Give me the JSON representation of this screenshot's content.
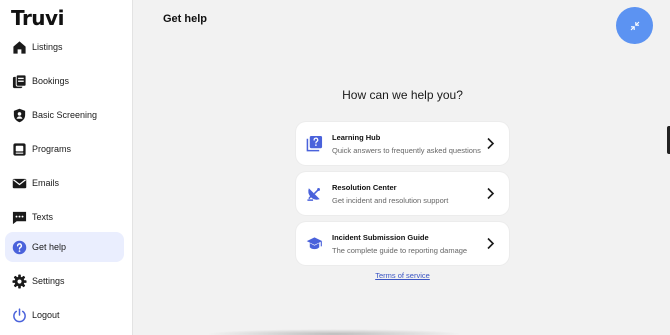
{
  "brand": {
    "logo_text": "Truvi",
    "accent_color": "#5c93f2",
    "active_bg": "#eaeefe"
  },
  "sidebar": {
    "items": [
      {
        "label": "Listings",
        "icon": "house-icon",
        "active": false
      },
      {
        "label": "Bookings",
        "icon": "bookings-icon",
        "active": false
      },
      {
        "label": "Basic Screening",
        "icon": "shield-user-icon",
        "active": false
      },
      {
        "label": "Programs",
        "icon": "programs-icon",
        "active": false
      },
      {
        "label": "Emails",
        "icon": "envelope-icon",
        "active": false
      },
      {
        "label": "Texts",
        "icon": "chat-bubble-icon",
        "active": false
      },
      {
        "label": "Get help",
        "icon": "question-circle-icon",
        "active": true
      },
      {
        "label": "Settings",
        "icon": "gear-icon",
        "active": false
      },
      {
        "label": "Logout",
        "icon": "power-icon",
        "active": false
      }
    ]
  },
  "header": {
    "title": "Get help",
    "fab_icon": "collapse-arrows-icon"
  },
  "main": {
    "heading": "How can we help you?",
    "cards": [
      {
        "title": "Learning Hub",
        "subtitle": "Quick answers to frequently asked questions",
        "icon": "question-book-icon"
      },
      {
        "title": "Resolution Center",
        "subtitle": "Get incident and resolution support",
        "icon": "satellite-dish-icon"
      },
      {
        "title": "Incident Submission Guide",
        "subtitle": "The complete guide to reporting damage",
        "icon": "graduation-cap-icon"
      }
    ],
    "terms_link": "Terms of service"
  }
}
